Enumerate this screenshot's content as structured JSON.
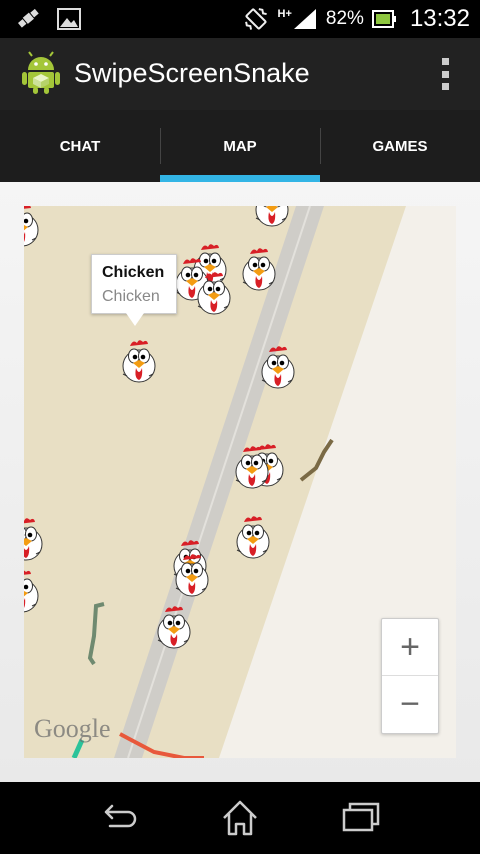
{
  "status_bar": {
    "battery_percent": "82%",
    "time": "13:32",
    "network_label": "H+"
  },
  "action_bar": {
    "app_title": "SwipeScreenSnake"
  },
  "tabs": [
    {
      "label": "CHAT",
      "active": false
    },
    {
      "label": "MAP",
      "active": true
    },
    {
      "label": "GAMES",
      "active": false
    }
  ],
  "map": {
    "info_window": {
      "title": "Chicken",
      "snippet": "Chicken"
    },
    "zoom_in_label": "+",
    "zoom_out_label": "−",
    "attribution": "Google"
  },
  "colors": {
    "accent": "#33b5e5",
    "map_land": "#e8dfc4",
    "map_road": "#cfcdc8",
    "route_orange": "#e8583b",
    "route_green": "#2bc39a"
  }
}
